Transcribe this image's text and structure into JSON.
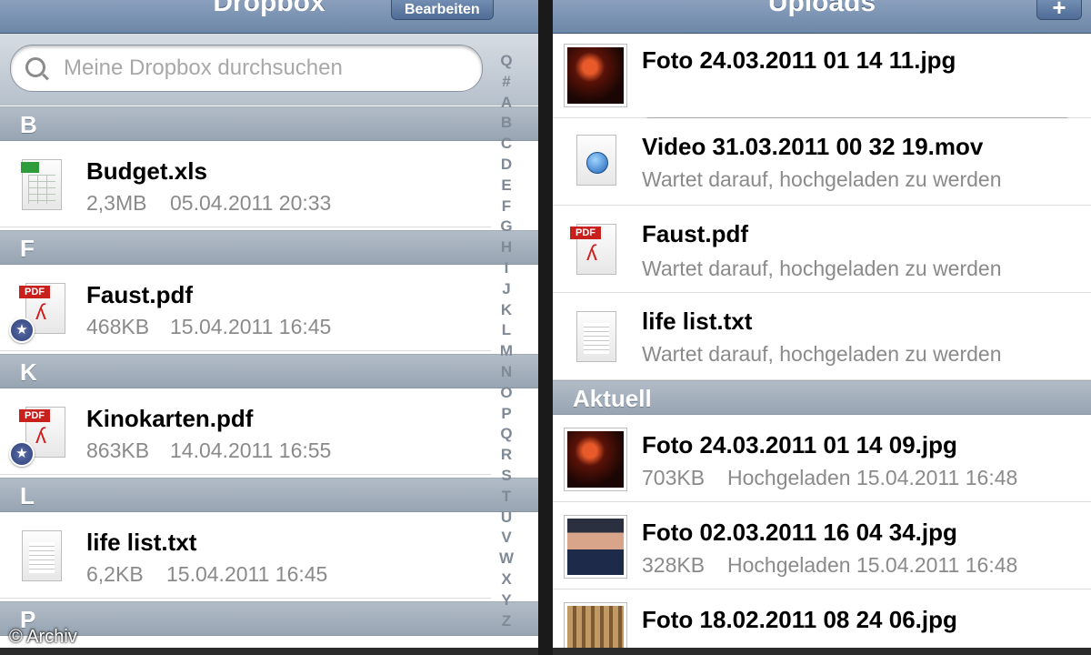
{
  "credit": "© Archiv",
  "left": {
    "nav_title": "Dropbox",
    "edit_button": "Bearbeiten",
    "search_placeholder": "Meine Dropbox durchsuchen",
    "index": [
      "Q",
      "#",
      "A",
      "B",
      "C",
      "D",
      "E",
      "F",
      "G",
      "H",
      "I",
      "J",
      "K",
      "L",
      "M",
      "N",
      "O",
      "P",
      "Q",
      "R",
      "S",
      "T",
      "U",
      "V",
      "W",
      "X",
      "Y",
      "Z"
    ],
    "sections": [
      {
        "letter": "B",
        "file": {
          "name": "Budget.xls",
          "size": "2,3MB",
          "date": "05.04.2011 20:33",
          "icon": "xls-file-icon",
          "favorite": false
        }
      },
      {
        "letter": "F",
        "file": {
          "name": "Faust.pdf",
          "size": "468KB",
          "date": "15.04.2011 16:45",
          "icon": "pdf-file-icon",
          "favorite": true
        }
      },
      {
        "letter": "K",
        "file": {
          "name": "Kinokarten.pdf",
          "size": "863KB",
          "date": "14.04.2011 16:55",
          "icon": "pdf-file-icon",
          "favorite": true
        }
      },
      {
        "letter": "L",
        "file": {
          "name": "life list.txt",
          "size": "6,2KB",
          "date": "15.04.2011 16:45",
          "icon": "txt-file-icon",
          "favorite": false
        }
      },
      {
        "letter": "P"
      }
    ]
  },
  "right": {
    "nav_title": "Uploads",
    "add_button": "+",
    "queue": [
      {
        "name": "Foto 24.03.2011 01 14 11.jpg",
        "progress": 0.4,
        "icon": "photo-thumbnail"
      },
      {
        "name": "Video 31.03.2011 00 32 19.mov",
        "status": "Wartet darauf, hochgeladen zu werden",
        "icon": "quicktime-file-icon"
      },
      {
        "name": "Faust.pdf",
        "status": "Wartet darauf, hochgeladen zu werden",
        "icon": "pdf-file-icon"
      },
      {
        "name": "life list.txt",
        "status": "Wartet darauf, hochgeladen zu werden",
        "icon": "txt-file-icon"
      }
    ],
    "recent_header": "Aktuell",
    "recent": [
      {
        "name": "Foto 24.03.2011 01 14 09.jpg",
        "size": "703KB",
        "status": "Hochgeladen 15.04.2011 16:48"
      },
      {
        "name": "Foto 02.03.2011 16 04 34.jpg",
        "size": "328KB",
        "status": "Hochgeladen 15.04.2011 16:48"
      },
      {
        "name": "Foto 18.02.2011 08 24 06.jpg"
      }
    ]
  }
}
